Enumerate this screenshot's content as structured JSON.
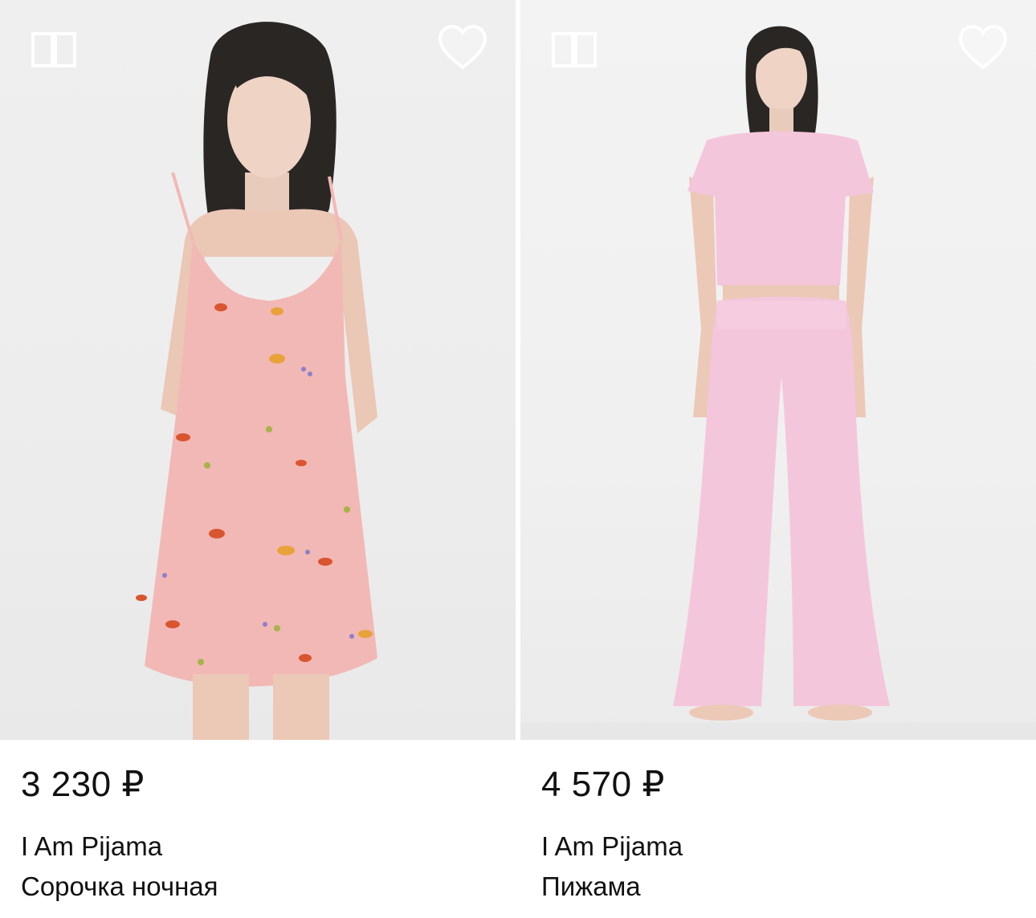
{
  "products": [
    {
      "price": "3 230 ₽",
      "brand": "I Am Pijama",
      "name": "Сорочка ночная",
      "image_desc": "model-in-pink-floral-slip-nightdress",
      "icons": {
        "compare": "compare-icon",
        "favorite": "heart-icon"
      }
    },
    {
      "price": "4 570 ₽",
      "brand": "I Am Pijama",
      "name": "Пижама",
      "image_desc": "model-in-pink-tshirt-and-flared-pants",
      "icons": {
        "compare": "compare-icon",
        "favorite": "heart-icon"
      }
    }
  ],
  "colors": {
    "background": "#ffffff",
    "image_bg": "#eeeeee",
    "garment_left": "#f2b8b5",
    "garment_right": "#f4c6dc",
    "icon_white": "#ffffff",
    "text": "#111111"
  }
}
